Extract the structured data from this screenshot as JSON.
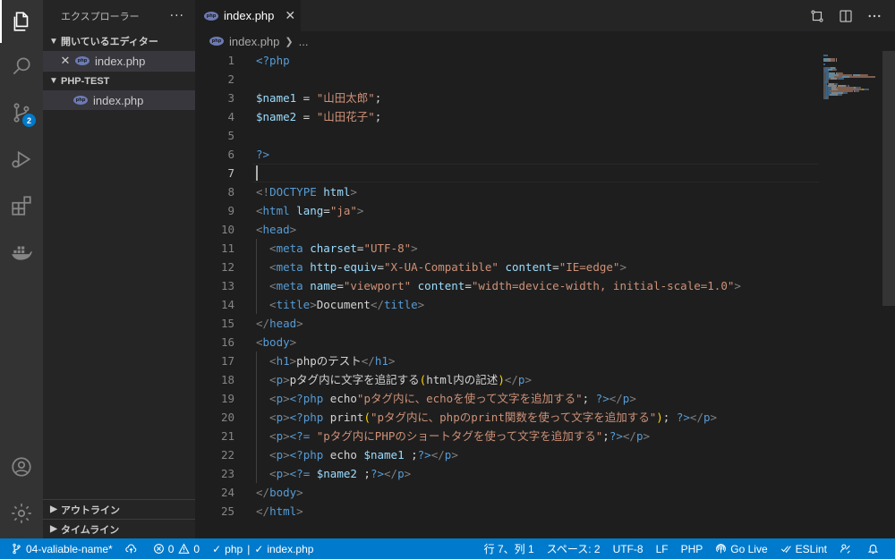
{
  "sidebar": {
    "title": "エクスプローラー",
    "more": "···",
    "open_editors": {
      "label": "開いているエディター",
      "items": [
        {
          "name": "index.php"
        }
      ]
    },
    "folder": {
      "label": "PHP-TEST",
      "items": [
        {
          "name": "index.php"
        }
      ]
    },
    "outline": "アウトライン",
    "timeline": "タイムライン"
  },
  "activity": {
    "scm_badge": "2"
  },
  "tabs": [
    {
      "label": "index.php"
    }
  ],
  "breadcrumb": {
    "file": "index.php",
    "more": "..."
  },
  "editor": {
    "cursor_line": 7,
    "lines": [
      {
        "n": "1",
        "tokens": [
          {
            "t": "<?php",
            "c": "t-kw"
          }
        ]
      },
      {
        "n": "2",
        "tokens": []
      },
      {
        "n": "3",
        "tokens": [
          {
            "t": "$name1",
            "c": "t-var"
          },
          {
            "t": " = ",
            "c": "t-txt"
          },
          {
            "t": "\"山田太郎\"",
            "c": "t-str"
          },
          {
            "t": ";",
            "c": "t-txt"
          }
        ]
      },
      {
        "n": "4",
        "tokens": [
          {
            "t": "$name2",
            "c": "t-var"
          },
          {
            "t": " = ",
            "c": "t-txt"
          },
          {
            "t": "\"山田花子\"",
            "c": "t-str"
          },
          {
            "t": ";",
            "c": "t-txt"
          }
        ]
      },
      {
        "n": "5",
        "tokens": []
      },
      {
        "n": "6",
        "tokens": [
          {
            "t": "?>",
            "c": "t-kw"
          }
        ]
      },
      {
        "n": "7",
        "tokens": []
      },
      {
        "n": "8",
        "tokens": [
          {
            "t": "<!",
            "c": "t-punc"
          },
          {
            "t": "DOCTYPE",
            "c": "t-doc"
          },
          {
            "t": " html",
            "c": "t-attr"
          },
          {
            "t": ">",
            "c": "t-punc"
          }
        ]
      },
      {
        "n": "9",
        "tokens": [
          {
            "t": "<",
            "c": "t-punc"
          },
          {
            "t": "html",
            "c": "t-tag"
          },
          {
            "t": " lang",
            "c": "t-attr"
          },
          {
            "t": "=",
            "c": "t-txt"
          },
          {
            "t": "\"ja\"",
            "c": "t-str"
          },
          {
            "t": ">",
            "c": "t-punc"
          }
        ]
      },
      {
        "n": "10",
        "tokens": [
          {
            "t": "<",
            "c": "t-punc"
          },
          {
            "t": "head",
            "c": "t-tag"
          },
          {
            "t": ">",
            "c": "t-punc"
          }
        ]
      },
      {
        "n": "11",
        "tokens": [
          {
            "t": "  <",
            "c": "t-punc"
          },
          {
            "t": "meta",
            "c": "t-tag"
          },
          {
            "t": " charset",
            "c": "t-attr"
          },
          {
            "t": "=",
            "c": "t-txt"
          },
          {
            "t": "\"UTF-8\"",
            "c": "t-str"
          },
          {
            "t": ">",
            "c": "t-punc"
          }
        ]
      },
      {
        "n": "12",
        "tokens": [
          {
            "t": "  <",
            "c": "t-punc"
          },
          {
            "t": "meta",
            "c": "t-tag"
          },
          {
            "t": " http-equiv",
            "c": "t-attr"
          },
          {
            "t": "=",
            "c": "t-txt"
          },
          {
            "t": "\"X-UA-Compatible\"",
            "c": "t-str"
          },
          {
            "t": " content",
            "c": "t-attr"
          },
          {
            "t": "=",
            "c": "t-txt"
          },
          {
            "t": "\"IE=edge\"",
            "c": "t-str"
          },
          {
            "t": ">",
            "c": "t-punc"
          }
        ]
      },
      {
        "n": "13",
        "tokens": [
          {
            "t": "  <",
            "c": "t-punc"
          },
          {
            "t": "meta",
            "c": "t-tag"
          },
          {
            "t": " name",
            "c": "t-attr"
          },
          {
            "t": "=",
            "c": "t-txt"
          },
          {
            "t": "\"viewport\"",
            "c": "t-str"
          },
          {
            "t": " content",
            "c": "t-attr"
          },
          {
            "t": "=",
            "c": "t-txt"
          },
          {
            "t": "\"width=device-width, initial-scale=1.0\"",
            "c": "t-str"
          },
          {
            "t": ">",
            "c": "t-punc"
          }
        ]
      },
      {
        "n": "14",
        "tokens": [
          {
            "t": "  <",
            "c": "t-punc"
          },
          {
            "t": "title",
            "c": "t-tag"
          },
          {
            "t": ">",
            "c": "t-punc"
          },
          {
            "t": "Document",
            "c": "t-txt"
          },
          {
            "t": "</",
            "c": "t-punc"
          },
          {
            "t": "title",
            "c": "t-tag"
          },
          {
            "t": ">",
            "c": "t-punc"
          }
        ]
      },
      {
        "n": "15",
        "tokens": [
          {
            "t": "</",
            "c": "t-punc"
          },
          {
            "t": "head",
            "c": "t-tag"
          },
          {
            "t": ">",
            "c": "t-punc"
          }
        ]
      },
      {
        "n": "16",
        "tokens": [
          {
            "t": "<",
            "c": "t-punc"
          },
          {
            "t": "body",
            "c": "t-tag"
          },
          {
            "t": ">",
            "c": "t-punc"
          }
        ]
      },
      {
        "n": "17",
        "tokens": [
          {
            "t": "  <",
            "c": "t-punc"
          },
          {
            "t": "h1",
            "c": "t-tag"
          },
          {
            "t": ">",
            "c": "t-punc"
          },
          {
            "t": "phpのテスト",
            "c": "t-txt"
          },
          {
            "t": "</",
            "c": "t-punc"
          },
          {
            "t": "h1",
            "c": "t-tag"
          },
          {
            "t": ">",
            "c": "t-punc"
          }
        ]
      },
      {
        "n": "18",
        "tokens": [
          {
            "t": "  <",
            "c": "t-punc"
          },
          {
            "t": "p",
            "c": "t-tag"
          },
          {
            "t": ">",
            "c": "t-punc"
          },
          {
            "t": "pタグ内に文字を追記する",
            "c": "t-txt"
          },
          {
            "t": "(",
            "c": "t-br"
          },
          {
            "t": "html内の記述",
            "c": "t-txt"
          },
          {
            "t": ")",
            "c": "t-br"
          },
          {
            "t": "</",
            "c": "t-punc"
          },
          {
            "t": "p",
            "c": "t-tag"
          },
          {
            "t": ">",
            "c": "t-punc"
          }
        ]
      },
      {
        "n": "19",
        "tokens": [
          {
            "t": "  <",
            "c": "t-punc"
          },
          {
            "t": "p",
            "c": "t-tag"
          },
          {
            "t": ">",
            "c": "t-punc"
          },
          {
            "t": "<?php",
            "c": "t-kw"
          },
          {
            "t": " echo",
            "c": "t-txt"
          },
          {
            "t": "\"pタグ内に、echoを使って文字を追加する\"",
            "c": "t-str"
          },
          {
            "t": "; ",
            "c": "t-txt"
          },
          {
            "t": "?>",
            "c": "t-kw"
          },
          {
            "t": "</",
            "c": "t-punc"
          },
          {
            "t": "p",
            "c": "t-tag"
          },
          {
            "t": ">",
            "c": "t-punc"
          }
        ]
      },
      {
        "n": "20",
        "tokens": [
          {
            "t": "  <",
            "c": "t-punc"
          },
          {
            "t": "p",
            "c": "t-tag"
          },
          {
            "t": ">",
            "c": "t-punc"
          },
          {
            "t": "<?php",
            "c": "t-kw"
          },
          {
            "t": " print",
            "c": "t-txt"
          },
          {
            "t": "(",
            "c": "t-br"
          },
          {
            "t": "\"pタグ内に、phpのprint関数を使って文字を追加する\"",
            "c": "t-str"
          },
          {
            "t": ")",
            "c": "t-br"
          },
          {
            "t": "; ",
            "c": "t-txt"
          },
          {
            "t": "?>",
            "c": "t-kw"
          },
          {
            "t": "</",
            "c": "t-punc"
          },
          {
            "t": "p",
            "c": "t-tag"
          },
          {
            "t": ">",
            "c": "t-punc"
          }
        ]
      },
      {
        "n": "21",
        "tokens": [
          {
            "t": "  <",
            "c": "t-punc"
          },
          {
            "t": "p",
            "c": "t-tag"
          },
          {
            "t": ">",
            "c": "t-punc"
          },
          {
            "t": "<?=",
            "c": "t-kw"
          },
          {
            "t": " \"pタグ内にPHPのショートタグを使って文字を追加する\"",
            "c": "t-str"
          },
          {
            "t": ";",
            "c": "t-txt"
          },
          {
            "t": "?>",
            "c": "t-kw"
          },
          {
            "t": "</",
            "c": "t-punc"
          },
          {
            "t": "p",
            "c": "t-tag"
          },
          {
            "t": ">",
            "c": "t-punc"
          }
        ]
      },
      {
        "n": "22",
        "tokens": [
          {
            "t": "  <",
            "c": "t-punc"
          },
          {
            "t": "p",
            "c": "t-tag"
          },
          {
            "t": ">",
            "c": "t-punc"
          },
          {
            "t": "<?php",
            "c": "t-kw"
          },
          {
            "t": " echo ",
            "c": "t-txt"
          },
          {
            "t": "$name1",
            "c": "t-var"
          },
          {
            "t": " ;",
            "c": "t-txt"
          },
          {
            "t": "?>",
            "c": "t-kw"
          },
          {
            "t": "</",
            "c": "t-punc"
          },
          {
            "t": "p",
            "c": "t-tag"
          },
          {
            "t": ">",
            "c": "t-punc"
          }
        ]
      },
      {
        "n": "23",
        "tokens": [
          {
            "t": "  <",
            "c": "t-punc"
          },
          {
            "t": "p",
            "c": "t-tag"
          },
          {
            "t": ">",
            "c": "t-punc"
          },
          {
            "t": "<?=",
            "c": "t-kw"
          },
          {
            "t": " ",
            "c": "t-txt"
          },
          {
            "t": "$name2",
            "c": "t-var"
          },
          {
            "t": " ;",
            "c": "t-txt"
          },
          {
            "t": "?>",
            "c": "t-kw"
          },
          {
            "t": "</",
            "c": "t-punc"
          },
          {
            "t": "p",
            "c": "t-tag"
          },
          {
            "t": ">",
            "c": "t-punc"
          }
        ]
      },
      {
        "n": "24",
        "tokens": [
          {
            "t": "</",
            "c": "t-punc"
          },
          {
            "t": "body",
            "c": "t-tag"
          },
          {
            "t": ">",
            "c": "t-punc"
          }
        ]
      },
      {
        "n": "25",
        "tokens": [
          {
            "t": "</",
            "c": "t-punc"
          },
          {
            "t": "html",
            "c": "t-tag"
          },
          {
            "t": ">",
            "c": "t-punc"
          }
        ]
      }
    ]
  },
  "status": {
    "branch": "04-valiable-name*",
    "errors": "0",
    "warnings": "0",
    "php_check": "php",
    "file_check": "index.php",
    "position": "行 7、列 1",
    "spaces": "スペース: 2",
    "encoding": "UTF-8",
    "eol": "LF",
    "language": "PHP",
    "golive": "Go Live",
    "eslint": "ESLint"
  },
  "colors": {
    "accent": "#007acc",
    "editor_bg": "#1e1e1e",
    "sidebar_bg": "#252526",
    "activity_bg": "#333333"
  }
}
